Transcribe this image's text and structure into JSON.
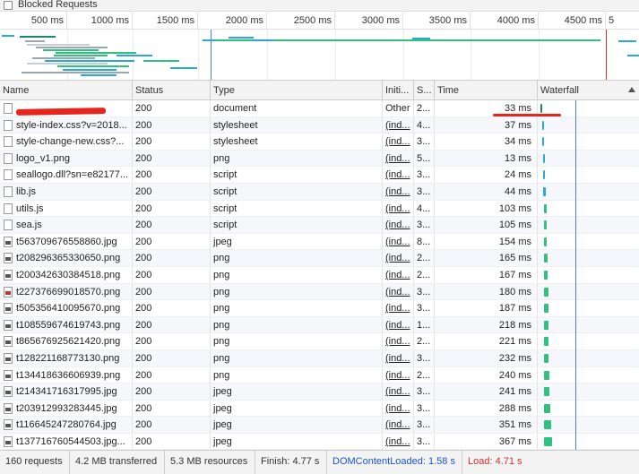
{
  "topbar": {
    "blocked_label": "Blocked Requests"
  },
  "ruler": {
    "ticks": [
      "500 ms",
      "1000 ms",
      "1500 ms",
      "2000 ms",
      "2500 ms",
      "3000 ms",
      "3500 ms",
      "4000 ms",
      "4500 ms",
      "5"
    ]
  },
  "columns": {
    "name": "Name",
    "status": "Status",
    "type": "Type",
    "initiator": "Initi...",
    "size": "S...",
    "time": "Time",
    "waterfall": "Waterfall"
  },
  "rows": [
    {
      "name": "",
      "status": "200",
      "type": "document",
      "initiator": "Other",
      "size": "2...",
      "time": "33 ms",
      "icon": "document-icon",
      "wf": [
        0.03,
        0.02,
        "#1b8b5e"
      ]
    },
    {
      "name": "style-index.css?v=2018...",
      "status": "200",
      "type": "stylesheet",
      "initiator": "(ind...",
      "size": "4...",
      "time": "37 ms",
      "icon": "document-icon",
      "wf": [
        0.04,
        0.02,
        "#2aa8d6"
      ]
    },
    {
      "name": "style-change-new.css?...",
      "status": "200",
      "type": "stylesheet",
      "initiator": "(ind...",
      "size": "3...",
      "time": "34 ms",
      "icon": "document-icon",
      "wf": [
        0.04,
        0.02,
        "#2aa8d6"
      ]
    },
    {
      "name": "logo_v1.png",
      "status": "200",
      "type": "png",
      "initiator": "(ind...",
      "size": "5...",
      "time": "13 ms",
      "icon": "document-icon",
      "wf": [
        0.05,
        0.01,
        "#2aa8d6"
      ]
    },
    {
      "name": "seallogo.dll?sn=e82177...",
      "status": "200",
      "type": "script",
      "initiator": "(ind...",
      "size": "3...",
      "time": "24 ms",
      "icon": "document-icon",
      "wf": [
        0.05,
        0.015,
        "#2aa8d6"
      ]
    },
    {
      "name": "lib.js",
      "status": "200",
      "type": "script",
      "initiator": "(ind...",
      "size": "3...",
      "time": "44 ms",
      "icon": "document-icon",
      "wf": [
        0.05,
        0.025,
        "#2aa8d6"
      ]
    },
    {
      "name": "utils.js",
      "status": "200",
      "type": "script",
      "initiator": "(ind...",
      "size": "4...",
      "time": "103 ms",
      "icon": "document-icon",
      "wf": [
        0.06,
        0.03,
        "#2ec27e"
      ]
    },
    {
      "name": "sea.js",
      "status": "200",
      "type": "script",
      "initiator": "(ind...",
      "size": "3...",
      "time": "105 ms",
      "icon": "document-icon",
      "wf": [
        0.06,
        0.03,
        "#2ec27e"
      ]
    },
    {
      "name": "t563709676558860.jpg",
      "status": "200",
      "type": "jpeg",
      "initiator": "(ind...",
      "size": "8...",
      "time": "154 ms",
      "icon": "image-icon",
      "wf": [
        0.06,
        0.03,
        "#2ec27e"
      ]
    },
    {
      "name": "t208296365330650.png",
      "status": "200",
      "type": "png",
      "initiator": "(ind...",
      "size": "2...",
      "time": "165 ms",
      "icon": "image-icon",
      "wf": [
        0.06,
        0.035,
        "#2ec27e"
      ]
    },
    {
      "name": "t200342630384518.png",
      "status": "200",
      "type": "png",
      "initiator": "(ind...",
      "size": "2...",
      "time": "167 ms",
      "icon": "image-icon",
      "wf": [
        0.06,
        0.035,
        "#2ec27e"
      ]
    },
    {
      "name": "t227376699018570.png",
      "status": "200",
      "type": "png",
      "initiator": "(ind...",
      "size": "3...",
      "time": "180 ms",
      "icon": "image-icon-red",
      "wf": [
        0.06,
        0.04,
        "#2ec27e"
      ]
    },
    {
      "name": "t505356410095670.png",
      "status": "200",
      "type": "png",
      "initiator": "(ind...",
      "size": "3...",
      "time": "187 ms",
      "icon": "image-icon",
      "wf": [
        0.06,
        0.04,
        "#2ec27e"
      ]
    },
    {
      "name": "t108559674619743.png",
      "status": "200",
      "type": "png",
      "initiator": "(ind...",
      "size": "1...",
      "time": "218 ms",
      "icon": "image-icon",
      "wf": [
        0.06,
        0.045,
        "#2ec27e"
      ]
    },
    {
      "name": "t865676925621420.png",
      "status": "200",
      "type": "png",
      "initiator": "(ind...",
      "size": "2...",
      "time": "221 ms",
      "icon": "image-icon",
      "wf": [
        0.06,
        0.045,
        "#2ec27e"
      ]
    },
    {
      "name": "t128221168773130.png",
      "status": "200",
      "type": "png",
      "initiator": "(ind...",
      "size": "3...",
      "time": "232 ms",
      "icon": "image-icon",
      "wf": [
        0.06,
        0.045,
        "#2ec27e"
      ]
    },
    {
      "name": "t134418636606939.png",
      "status": "200",
      "type": "png",
      "initiator": "(ind...",
      "size": "2...",
      "time": "240 ms",
      "icon": "image-icon",
      "wf": [
        0.06,
        0.05,
        "#2ec27e"
      ]
    },
    {
      "name": "t214341716317995.jpg",
      "status": "200",
      "type": "jpeg",
      "initiator": "(ind...",
      "size": "3...",
      "time": "241 ms",
      "icon": "image-icon",
      "wf": [
        0.06,
        0.05,
        "#2ec27e"
      ]
    },
    {
      "name": "t203912993283445.jpg",
      "status": "200",
      "type": "jpeg",
      "initiator": "(ind...",
      "size": "3...",
      "time": "288 ms",
      "icon": "image-icon",
      "wf": [
        0.06,
        0.06,
        "#2ec27e"
      ]
    },
    {
      "name": "t116645247280764.jpg",
      "status": "200",
      "type": "jpeg",
      "initiator": "(ind...",
      "size": "3...",
      "time": "351 ms",
      "icon": "image-icon",
      "wf": [
        0.06,
        0.07,
        "#2ec27e"
      ]
    },
    {
      "name": "t137716760544503.jpg...",
      "status": "200",
      "type": "jpeg",
      "initiator": "(ind...",
      "size": "3...",
      "time": "367 ms",
      "icon": "image-icon",
      "wf": [
        0.06,
        0.075,
        "#2ec27e"
      ]
    }
  ],
  "status_bar": {
    "requests": "160 requests",
    "transferred": "4.2 MB transferred",
    "resources": "5.3 MB resources",
    "finish": "Finish: 4.77 s",
    "dcl": "DOMContentLoaded: 1.58 s",
    "load": "Load: 4.71 s"
  },
  "colors": {
    "dcl_line": "#4a7ee0",
    "load_line": "#d0312d",
    "annotation_red": "#e8251c"
  }
}
